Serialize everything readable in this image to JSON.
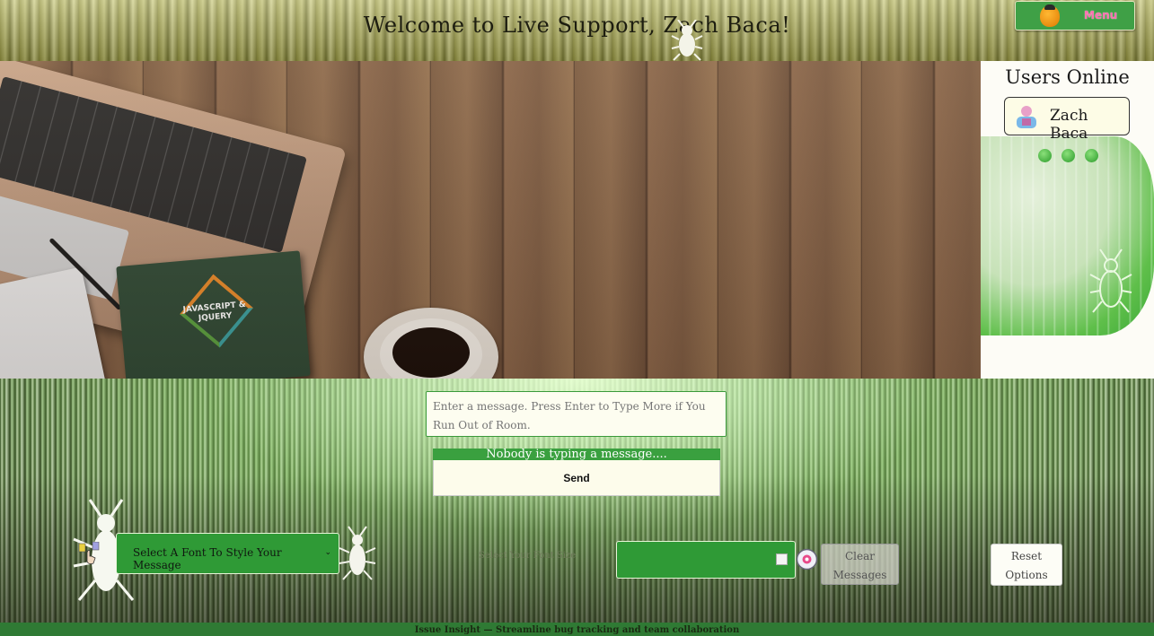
{
  "header": {
    "welcome": "Welcome to Live Support, Zach Baca!",
    "menu_label": "Menu",
    "menu_icon": "acorn-icon"
  },
  "hero": {
    "book_title": "JAVASCRIPT & JQUERY"
  },
  "users_online": {
    "title": "Users Online",
    "users": [
      {
        "name": "Zach Baca",
        "avatar": "person-avatar-icon"
      }
    ],
    "typing_indicator_dots": 3
  },
  "composer": {
    "message_placeholder": "Enter a message. Press Enter to Type More if You Run Out of Room.",
    "typing_status": "Nobody is typing a message....",
    "send_label": "Send"
  },
  "options": {
    "font_select_value": "Select A Font To Style Your Message",
    "font_size_label": "Select Your Font Size",
    "clear_label": "Clear Messages",
    "reset_label": "Reset Options"
  },
  "footer": {
    "tagline": "Issue Insight — Streamline bug tracking and team collaboration"
  },
  "colors": {
    "accent_green": "#3aa03f",
    "menu_text": "#ff6fb0"
  }
}
